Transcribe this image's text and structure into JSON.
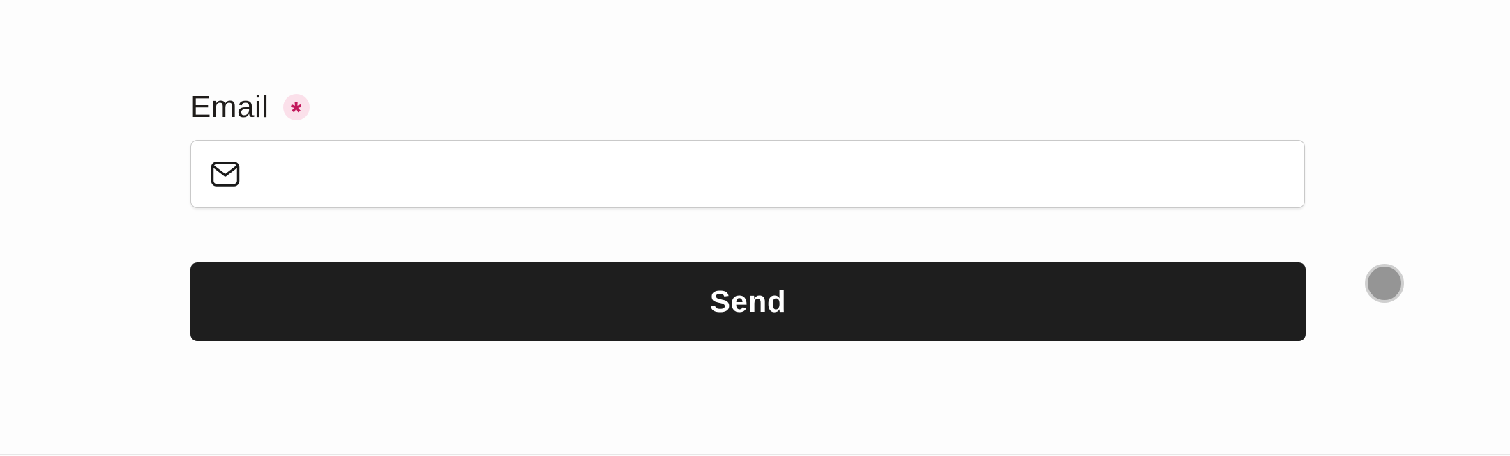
{
  "form": {
    "email_label": "Email",
    "required_marker": "*",
    "email_value": "",
    "email_placeholder": "",
    "email_icon": "mail-icon",
    "send_label": "Send"
  },
  "colors": {
    "button_background": "#1e1e1e",
    "button_text": "#ffffff",
    "required_marker": "#c2185b",
    "required_badge_bg": "#fbe0ea",
    "input_border": "#c9c9c9",
    "page_background": "#fdfdfd"
  }
}
